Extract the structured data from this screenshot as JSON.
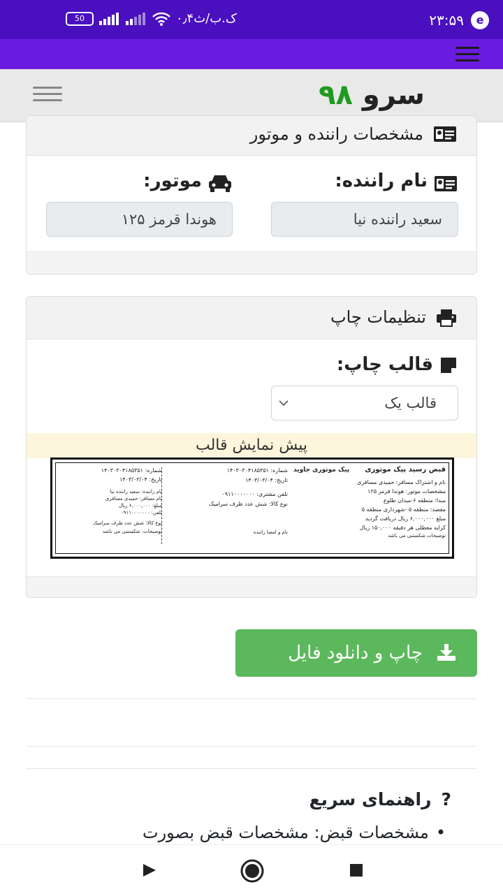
{
  "status_bar": {
    "left_text": "۰٫۴ک.ب/ث",
    "battery": "50",
    "time": "۲۳:۵۹"
  },
  "header": {
    "logo_text": "سرو",
    "logo_number": "۹۸"
  },
  "driver_card": {
    "title": "مشخصات راننده و موتور",
    "driver_label": "نام راننده:",
    "driver_value": "سعید راننده نیا",
    "motor_label": "موتور:",
    "motor_value": "هوندا قرمز ۱۲۵"
  },
  "print_card": {
    "title": "تنظیمات چاپ",
    "template_label": "قالب چاپ:",
    "template_selected": "قالب یک",
    "preview_title": "پیش نمایش قالب"
  },
  "receipt": {
    "title": "قبض رسید پیک موتوری",
    "company": "پیک موتوری جاوید",
    "lines_main": [
      "نام و اشتراک مسافر: حمیدی مسافری",
      "مشخصات موتور: هوندا قرمز ۱۲۵",
      "مبدا: منطقه ۶-میدان طلوع",
      "مقصد: منطقه ۵ -شهرداری منطقه ۵",
      "مبلغ ۶,۰۰۰,۰۰۰ ریال دریافت گردید",
      "کرایه معطلی هر دقیقه ۱۵۰,۰۰۰ ریال",
      "توضیحات شکستنی می باشد"
    ],
    "mid_number": "شماره: ۱۴۰۳۰۳۰۴۱۸۵۳۵۱",
    "mid_date": "تاریخ: ۱۴۰۳/۰۳/۰۴",
    "mid_phone": "تلفن مشتری: ۰۹۱۱۰۰۰۰۰۰۰",
    "mid_goods": "نوع کالا: شش عدد ظرف سرامیک",
    "mid_sign": "نام و امضا راننده",
    "stub_number": "شماره: ۱۴۰۳۰۳۰۴۱۸۵۳۵۱",
    "stub_date": "تاریخ: ۱۴۰۳/۰۳/۰۴",
    "stub_lines": [
      "نام راننده: سعید راننده نیا",
      "نام مسافر: حمیدی مسافری",
      "مبلغ: ۶,۰۰۰,۰۰۰ ریال",
      "تلفن: ۰۹۱۱۰۰۰۰۰۰۰",
      "نوع کالا: شش عدد ظرف سرامیک",
      "توضیحات: شکستنی می باشد"
    ]
  },
  "actions": {
    "print_download": "چاپ و دانلود فایل"
  },
  "guide": {
    "title": "راهنمای سریع",
    "bullet": "مشخصات قبض: مشخصات قبض بصورت"
  }
}
